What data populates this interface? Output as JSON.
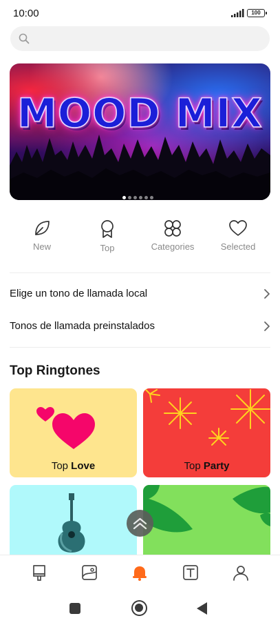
{
  "status_bar": {
    "time": "10:00",
    "battery": "100"
  },
  "search": {
    "placeholder": ""
  },
  "banner": {
    "title": "MOOD MIX",
    "slide_count": 6,
    "active_slide": 1
  },
  "quick_links": [
    {
      "label": "New",
      "icon": "leaf-icon"
    },
    {
      "label": "Top",
      "icon": "award-ribbon-icon"
    },
    {
      "label": "Categories",
      "icon": "four-petal-grid-icon"
    },
    {
      "label": "Selected",
      "icon": "heart-outline-icon"
    }
  ],
  "rows": [
    {
      "label": "Elige un tono de llamada local"
    },
    {
      "label": "Tonos de llamada preinstalados"
    }
  ],
  "section": {
    "title": "Top Ringtones"
  },
  "cards": [
    {
      "prefix": "Top ",
      "bold": "Love",
      "bg": "#fee58e",
      "art": "hearts"
    },
    {
      "prefix": "Top ",
      "bold": "Party",
      "bg": "#f43d3a",
      "art": "fireworks"
    },
    {
      "prefix": "",
      "bold": "",
      "bg": "#b0f9fb",
      "art": "guitar"
    },
    {
      "prefix": "",
      "bold": "",
      "bg": "#82e05c",
      "art": "palm-leaves"
    }
  ],
  "tabbar": [
    {
      "icon": "wallpaper-brush-icon",
      "active": false
    },
    {
      "icon": "image-gallery-icon",
      "active": false
    },
    {
      "icon": "bell-ringtone-icon",
      "active": true
    },
    {
      "icon": "text-font-icon",
      "active": false
    },
    {
      "icon": "profile-user-icon",
      "active": false
    }
  ],
  "colors": {
    "accent": "#ff6a1a",
    "icon_gray": "#4a4a4a",
    "label_gray": "#8a8a8a"
  }
}
